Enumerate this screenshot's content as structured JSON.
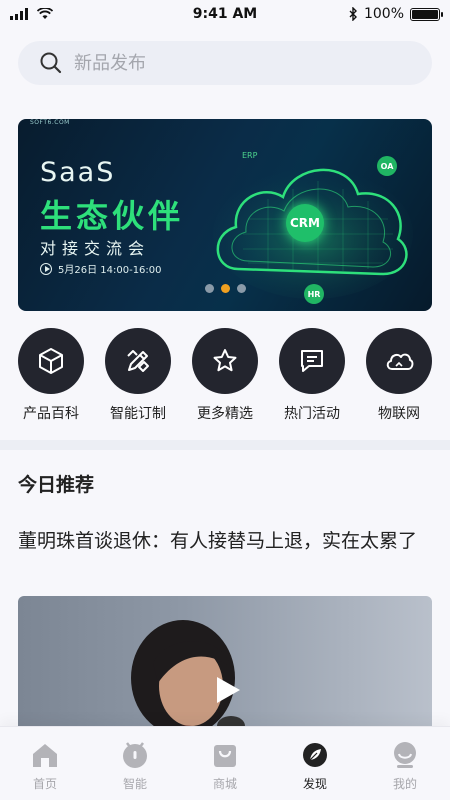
{
  "status_bar": {
    "time": "9:41 AM",
    "battery": "100%",
    "battery_level": 1.0
  },
  "search": {
    "placeholder": "新品发布"
  },
  "banner": {
    "brand": "SOFT6.COM",
    "line1": "SaaS",
    "line2": "生态伙伴",
    "line3": "对接交流会",
    "date": "5月26日 14:00-16:00",
    "tags": {
      "crm": "CRM",
      "oa": "OA",
      "hr": "HR",
      "erp": "ERP"
    },
    "carousel": {
      "count": 3,
      "active_index": 1
    }
  },
  "categories": [
    {
      "label": "产品百科",
      "icon": "cube-icon"
    },
    {
      "label": "智能订制",
      "icon": "pencil-ruler-icon"
    },
    {
      "label": "更多精选",
      "icon": "star-icon"
    },
    {
      "label": "热门活动",
      "icon": "message-icon"
    },
    {
      "label": "物联网",
      "icon": "cloud-icon"
    }
  ],
  "recommend": {
    "title": "今日推荐",
    "article": {
      "title": "董明珠首谈退休：有人接替马上退，实在太累了"
    }
  },
  "tabbar": {
    "active": "发现",
    "items": [
      {
        "label": "首页",
        "icon": "home-icon"
      },
      {
        "label": "智能",
        "icon": "robot-icon"
      },
      {
        "label": "商城",
        "icon": "shopping-bag-icon"
      },
      {
        "label": "发现",
        "icon": "compass-leaf-icon"
      },
      {
        "label": "我的",
        "icon": "profile-icon"
      }
    ]
  },
  "colors": {
    "accent_green": "#2ee07b",
    "dark_circle": "#23252e",
    "carousel_active": "#f0a020"
  }
}
